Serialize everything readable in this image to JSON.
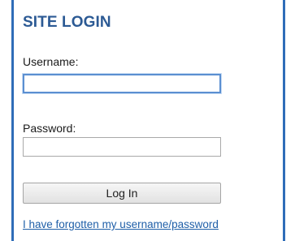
{
  "login": {
    "title": "SITE LOGIN",
    "username_label": "Username:",
    "username_value": "",
    "password_label": "Password:",
    "password_value": "",
    "submit_label": "Log In",
    "forgot_link": "I have forgotten my username/password"
  },
  "colors": {
    "border_accent": "#2f6db8",
    "title": "#2c5a94",
    "link": "#1f5fa8",
    "focus_ring": "#5b8fd1"
  }
}
